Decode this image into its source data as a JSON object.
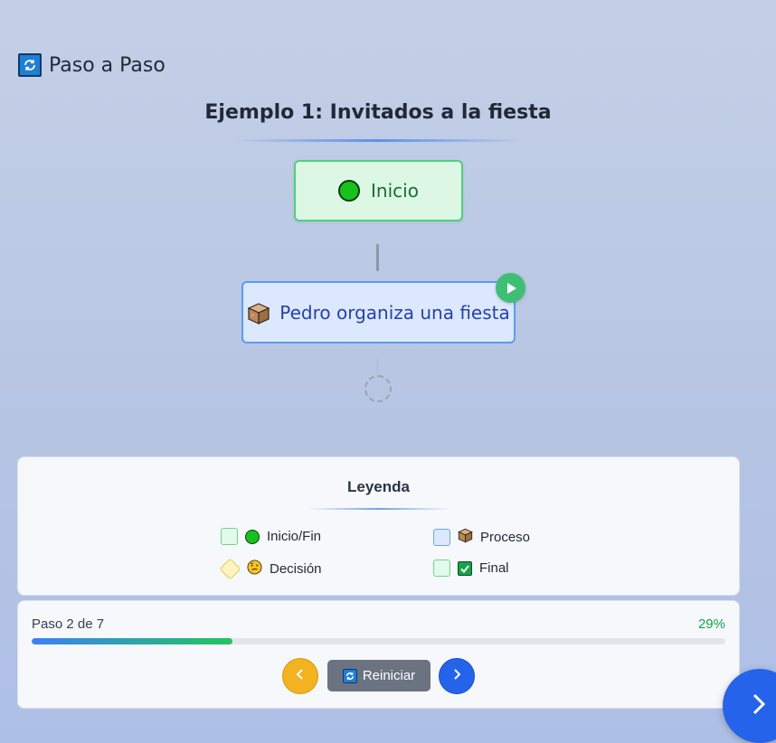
{
  "app": {
    "title": "Paso a Paso",
    "icon": "refresh-icon"
  },
  "example": {
    "title": "Ejemplo 1: Invitados a la fiesta"
  },
  "flow": {
    "start_node": {
      "label": "Inicio",
      "icon": "green-circle-icon"
    },
    "process_node": {
      "label": "Pedro organiza una fiesta",
      "icon": "package-box-icon"
    },
    "current_badge_icon": "play-icon",
    "pending_node_icon": "dashed-circle-icon"
  },
  "legend": {
    "title": "Leyenda",
    "items": [
      {
        "label": "Inicio/Fin",
        "icon": "green-circle-icon"
      },
      {
        "label": "Proceso",
        "icon": "package-box-icon"
      },
      {
        "label": "Decisión",
        "icon": "thinking-face-icon"
      },
      {
        "label": "Final",
        "icon": "check-mark-icon"
      }
    ]
  },
  "progress": {
    "step_text": "Paso 2 de 7",
    "percent_text": "29%",
    "fraction": 0.29
  },
  "controls": {
    "prev_icon": "chevron-left-icon",
    "reset_label": "Reiniciar",
    "reset_icon": "refresh-icon",
    "next_icon": "chevron-right-icon"
  },
  "colors": {
    "start": "#dcf8e4",
    "process": "#dbe8fd",
    "prev_button": "#f3b21f",
    "next_button": "#2563eb",
    "progress_percent": "#16a34a"
  }
}
